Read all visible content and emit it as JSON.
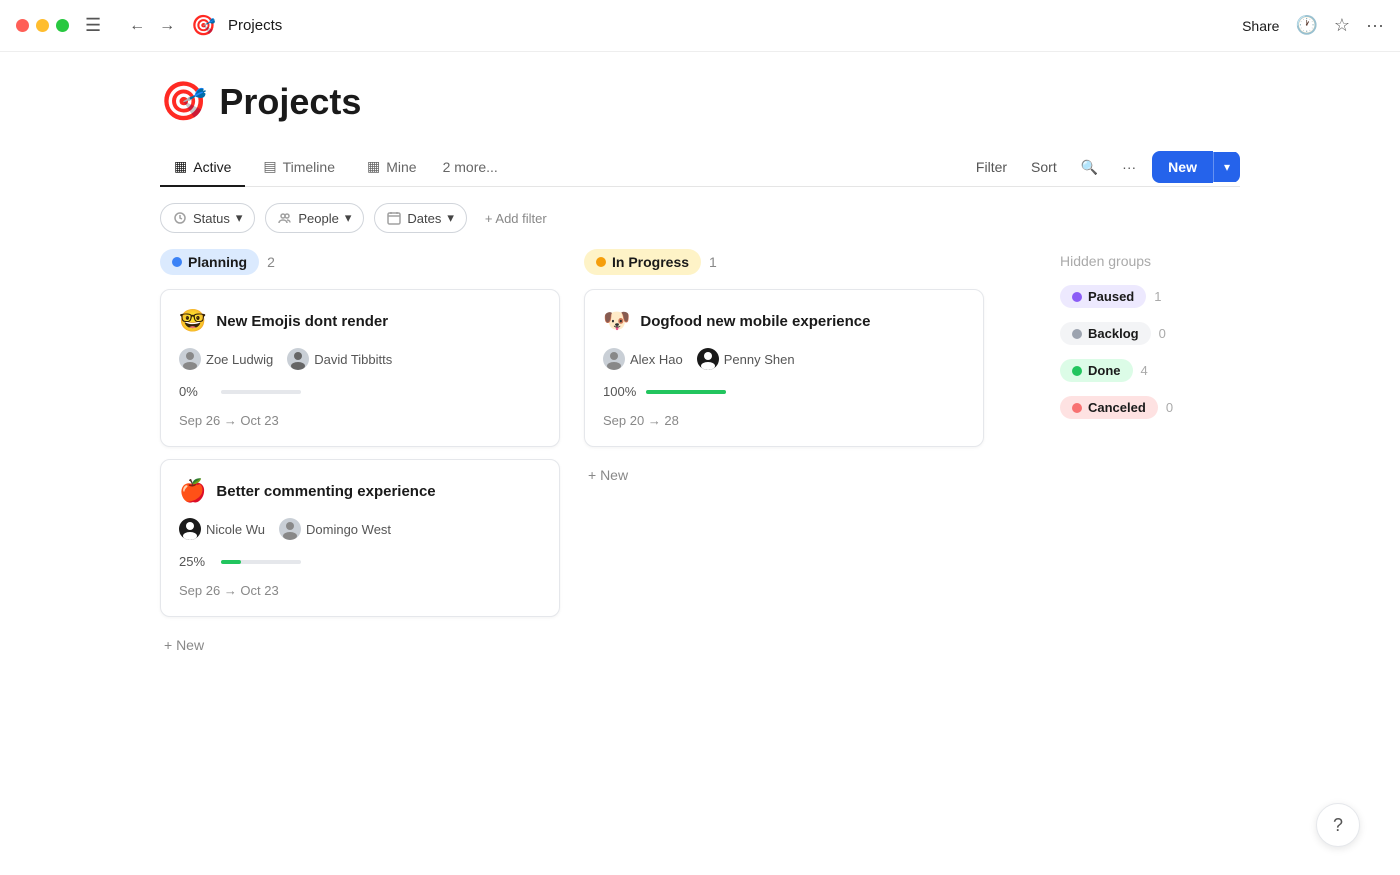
{
  "titlebar": {
    "app_title": "Projects",
    "share_label": "Share",
    "menu_icon": "☰",
    "back_icon": "←",
    "forward_icon": "→",
    "app_emoji": "🎯",
    "history_icon": "🕐",
    "star_icon": "☆",
    "more_icon": "···"
  },
  "page": {
    "emoji": "🎯",
    "title": "Projects"
  },
  "tabs": [
    {
      "id": "active",
      "icon": "▦",
      "label": "Active",
      "active": true
    },
    {
      "id": "timeline",
      "icon": "▤",
      "label": "Timeline",
      "active": false
    },
    {
      "id": "mine",
      "icon": "▦",
      "label": "Mine",
      "active": false
    }
  ],
  "tabs_more": "2 more...",
  "toolbar": {
    "filter_label": "Filter",
    "sort_label": "Sort",
    "search_icon": "🔍",
    "more_icon": "···",
    "new_label": "New",
    "dropdown_icon": "▾"
  },
  "filters": {
    "status_label": "Status",
    "people_label": "People",
    "dates_label": "Dates",
    "add_filter_label": "+ Add filter"
  },
  "columns": [
    {
      "id": "planning",
      "status_label": "Planning",
      "status_class": "status-planning",
      "dot_class": "dot-planning",
      "count": 2,
      "cards": [
        {
          "id": "card1",
          "emoji": "🤓",
          "title": "New Emojis dont  render",
          "people": [
            {
              "name": "Zoe Ludwig",
              "avatar_color": "#d1d5db"
            },
            {
              "name": "David Tibbitts",
              "avatar_color": "#d1d5db"
            }
          ],
          "progress": 0,
          "progress_label": "0%",
          "progress_fill_class": "fill-zero",
          "date_range": "Sep 26 → Oct 23"
        },
        {
          "id": "card2",
          "emoji": "🍎",
          "title": "Better commenting experience",
          "people": [
            {
              "name": "Nicole Wu",
              "avatar_color": "#1a1a1a"
            },
            {
              "name": "Domingo West",
              "avatar_color": "#d1d5db"
            }
          ],
          "progress": 25,
          "progress_label": "25%",
          "progress_fill_class": "fill-25",
          "date_range": "Sep 26 → Oct 23"
        }
      ],
      "add_new_label": "+ New"
    },
    {
      "id": "inprogress",
      "status_label": "In Progress",
      "status_class": "status-inprogress",
      "dot_class": "dot-inprogress",
      "count": 1,
      "cards": [
        {
          "id": "card3",
          "emoji": "🐶",
          "title": "Dogfood new mobile experience",
          "people": [
            {
              "name": "Alex Hao",
              "avatar_color": "#d1d5db"
            },
            {
              "name": "Penny Shen",
              "avatar_color": "#1a1a1a"
            }
          ],
          "progress": 100,
          "progress_label": "100%",
          "progress_fill_class": "fill-100",
          "date_range": "Sep 20 → 28"
        }
      ],
      "add_new_label": "+ New"
    }
  ],
  "hidden_groups": {
    "title": "Hidden groups",
    "items": [
      {
        "id": "paused",
        "label": "Paused",
        "count": 1,
        "badge_class": "hg-paused",
        "dot_class": "dot-paused"
      },
      {
        "id": "backlog",
        "label": "Backlog",
        "count": 0,
        "badge_class": "hg-backlog",
        "dot_class": "dot-backlog"
      },
      {
        "id": "done",
        "label": "Done",
        "count": 4,
        "badge_class": "hg-done",
        "dot_class": "dot-done"
      },
      {
        "id": "canceled",
        "label": "Canceled",
        "count": 0,
        "badge_class": "hg-canceled",
        "dot_class": "dot-canceled"
      }
    ]
  },
  "help": {
    "icon": "?"
  }
}
